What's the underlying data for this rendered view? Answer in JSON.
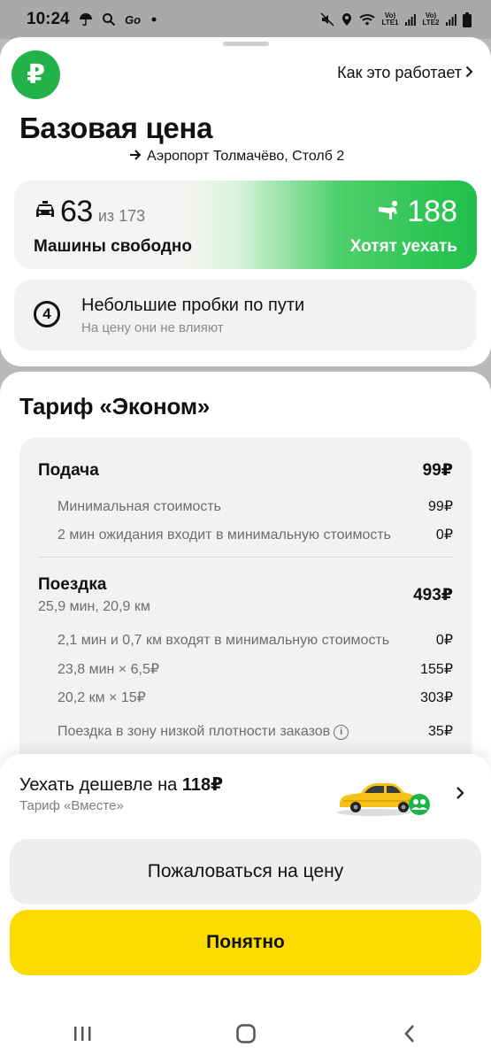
{
  "status_bar": {
    "time": "10:24",
    "lte1": "Vo) LTE1",
    "lte2": "Vo) LTE2"
  },
  "header": {
    "how_it_works": "Как это работает",
    "title": "Базовая цена",
    "route": "Аэропорт Толмачёво, Столб 2"
  },
  "supply": {
    "free_count": "63",
    "free_total": "из 173",
    "free_label": "Машины свободно",
    "demand_count": "188",
    "demand_label": "Хотят уехать"
  },
  "traffic": {
    "level": "4",
    "title": "Небольшие пробки по пути",
    "subtitle": "На цену они не влияют"
  },
  "tariff": {
    "title": "Тариф «Эконом»",
    "pickup": {
      "label": "Подача",
      "value": "99₽",
      "items": [
        {
          "label": "Минимальная стоимость",
          "value": "99₽"
        },
        {
          "label": "2 мин ожидания входит в минимальную стоимость",
          "value": "0₽"
        }
      ]
    },
    "trip": {
      "label": "Поездка",
      "details": "25,9 мин, 20,9 км",
      "value": "493₽",
      "items": [
        {
          "label": "2,1 мин и 0,7 км входят в минимальную стоимость",
          "value": "0₽"
        },
        {
          "label": "23,8 мин × 6,5₽",
          "value": "155₽"
        },
        {
          "label": "20,2 км × 15₽",
          "value": "303₽"
        },
        {
          "label": "Поездка в зону низкой плотности заказов",
          "value": "35₽"
        }
      ]
    }
  },
  "cheaper_offer": {
    "prefix": "Уехать дешевле на ",
    "amount": "118₽",
    "tariff": "Тариф «Вместе»"
  },
  "buttons": {
    "complain": "Пожаловаться на цену",
    "ok": "Понятно"
  },
  "colors": {
    "brand_green": "#21b34a",
    "accent_yellow": "#fcdc00",
    "demand_green": "#1fbf4a"
  }
}
